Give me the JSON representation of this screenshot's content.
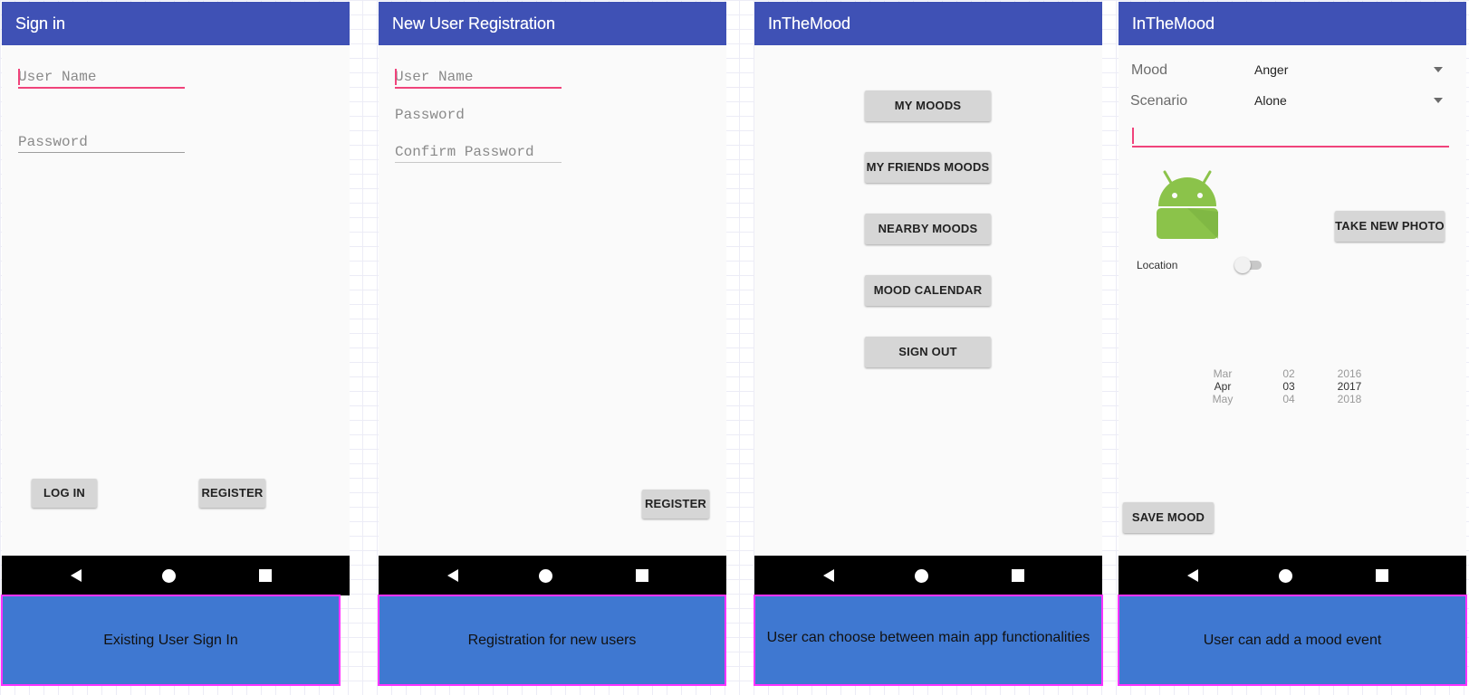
{
  "screens": [
    {
      "title": "Sign in",
      "fields": {
        "username_placeholder": "User Name",
        "password_placeholder": "Password"
      },
      "buttons": {
        "login": "LOG IN",
        "register": "REGISTER"
      },
      "caption": "Existing User Sign In"
    },
    {
      "title": "New User Registration",
      "fields": {
        "username_placeholder": "User Name",
        "password_placeholder": "Password",
        "confirm_placeholder": "Confirm Password"
      },
      "buttons": {
        "register": "REGISTER"
      },
      "caption": "Registration for new users"
    },
    {
      "title": "InTheMood",
      "menu": [
        "MY MOODS",
        "MY FRIENDS MOODS",
        "NEARBY MOODS",
        "MOOD CALENDAR",
        "SIGN OUT"
      ],
      "caption": "User can choose between main app functionalities"
    },
    {
      "title": "InTheMood",
      "mood_label": "Mood",
      "mood_value": "Anger",
      "scenario_label": "Scenario",
      "scenario_value": "Alone",
      "photo_button": "TAKE NEW PHOTO",
      "location_label": "Location",
      "location_on": false,
      "date_picker": {
        "months": [
          "Mar",
          "Apr",
          "May"
        ],
        "days": [
          "02",
          "03",
          "04"
        ],
        "years": [
          "2016",
          "2017",
          "2018"
        ]
      },
      "save_button": "SAVE MOOD",
      "caption": "User can add a mood event"
    }
  ],
  "icons": {
    "android": "android-robot-icon",
    "back": "nav-back-icon",
    "home": "nav-home-icon",
    "recent": "nav-recent-icon"
  },
  "colors": {
    "appbar": "#3f51b5",
    "accent": "#f0437b",
    "caption_bg": "#3f78d1",
    "caption_border": "#ff33ff",
    "android_green": "#8bc34a"
  }
}
